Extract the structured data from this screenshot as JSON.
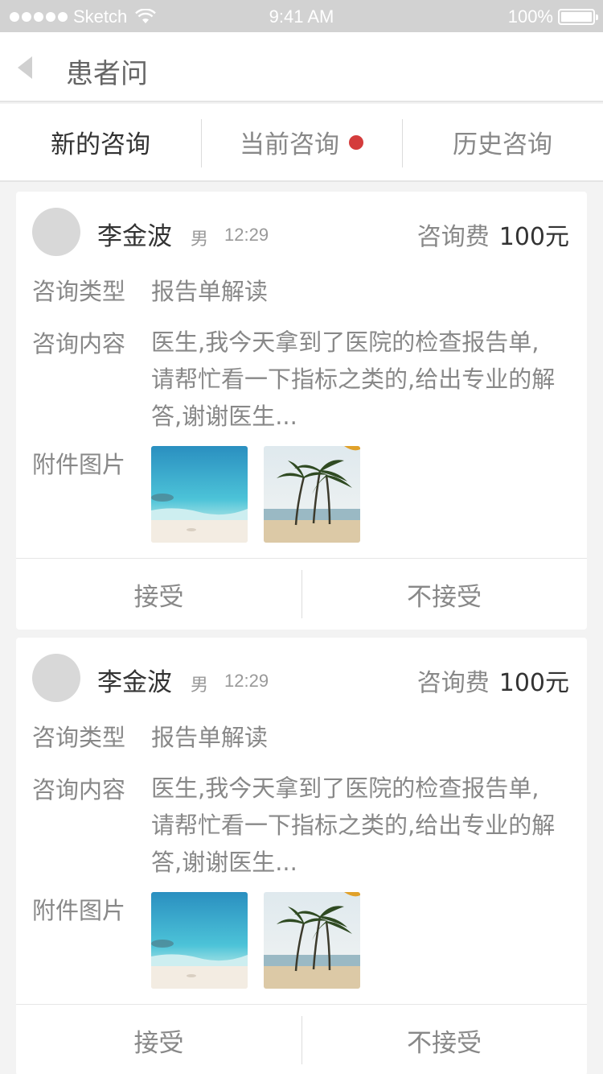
{
  "status_bar": {
    "carrier": "Sketch",
    "time": "9:41 AM",
    "battery": "100%"
  },
  "nav": {
    "title": "患者问",
    "back_icon": "chevron-left-icon"
  },
  "tabs": [
    {
      "label": "新的咨询",
      "active": true
    },
    {
      "label": "当前咨询",
      "badge": true
    },
    {
      "label": "历史咨询"
    }
  ],
  "colors": {
    "badge": "#d43c3c",
    "status_bar_bg": "#d2d2d2",
    "page_bg": "#f3f3f3"
  },
  "consultations": [
    {
      "name": "李金波",
      "gender": "男",
      "time": "12:29",
      "fee_label": "咨询费",
      "fee_value": "100元",
      "type_label": "咨询类型",
      "type_value": "报告单解读",
      "content_label": "咨询内容",
      "content_value": "医生,我今天拿到了医院的检查报告单,请帮忙看一下指标之类的,给出专业的解答,谢谢医生...",
      "attachments_label": "附件图片",
      "attachments": [
        "beach-sea-photo",
        "palm-trees-photo"
      ],
      "accept_label": "接受",
      "reject_label": "不接受"
    },
    {
      "name": "李金波",
      "gender": "男",
      "time": "12:29",
      "fee_label": "咨询费",
      "fee_value": "100元",
      "type_label": "咨询类型",
      "type_value": "报告单解读",
      "content_label": "咨询内容",
      "content_value": "医生,我今天拿到了医院的检查报告单,请帮忙看一下指标之类的,给出专业的解答,谢谢医生...",
      "attachments_label": "附件图片",
      "attachments": [
        "beach-sea-photo",
        "palm-trees-photo"
      ],
      "accept_label": "接受",
      "reject_label": "不接受"
    }
  ]
}
